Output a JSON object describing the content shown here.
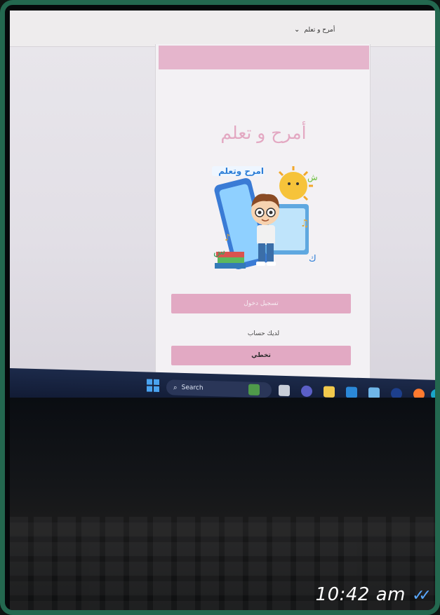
{
  "topbar": {
    "menu_label": "أمرح و تعلم",
    "menu_icon": "chevron-down-icon"
  },
  "page": {
    "title": "أمرح و تعلم",
    "illustration_title": "امرح وتعلم",
    "illustration_letters": [
      "ش",
      "س",
      "ك"
    ],
    "register_button": "تسجيل دخول",
    "account_prompt": "لديك حساب",
    "login_button": "تخطي"
  },
  "taskbar": {
    "search_placeholder": "Search"
  },
  "message": {
    "timestamp": "10:42 am",
    "status_icon": "double-check-icon"
  },
  "colors": {
    "accent_pink": "#e2a9c3",
    "frame_green": "#23684f",
    "taskbar": "#1c2a4a",
    "read_ticks": "#5aa8ff"
  }
}
